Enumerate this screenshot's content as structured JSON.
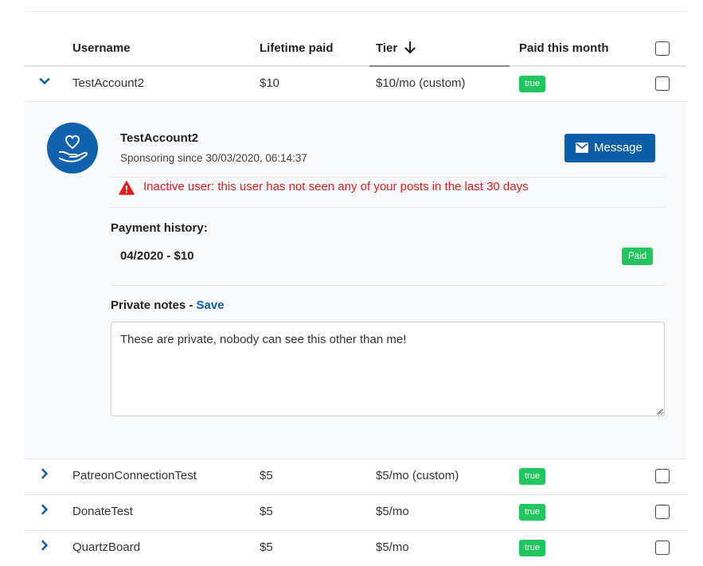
{
  "table": {
    "headers": {
      "username": "Username",
      "lifetime_paid": "Lifetime paid",
      "tier": "Tier",
      "paid_this_month": "Paid this month",
      "sort_icon": "arrow-down-icon"
    },
    "expanded_row": {
      "username": "TestAccount2",
      "lifetime_paid": "$10",
      "tier": "$10/mo (custom)",
      "paid_this_month": "true"
    },
    "rows": [
      {
        "username": "PatreonConnectionTest",
        "lifetime_paid": "$5",
        "tier": "$5/mo (custom)",
        "paid_this_month": "true"
      },
      {
        "username": "DonateTest",
        "lifetime_paid": "$5",
        "tier": "$5/mo",
        "paid_this_month": "true"
      },
      {
        "username": "QuartzBoard",
        "lifetime_paid": "$5",
        "tier": "$5/mo",
        "paid_this_month": "true"
      }
    ]
  },
  "detail": {
    "name": "TestAccount2",
    "sponsoring_since": "Sponsoring since 30/03/2020, 06:14:37",
    "message_button": "Message",
    "warning": "Inactive user: this user has not seen any of your posts in the last 30 days",
    "payment_history_label": "Payment history:",
    "payment_item": "04/2020 - $10",
    "payment_status": "Paid",
    "private_notes_label": "Private notes - ",
    "save_label": "Save",
    "notes_text": "These are private, nobody can see this other than me!",
    "avatar_icon": "hand-heart-icon"
  },
  "colors": {
    "accent": "#0d5ea8",
    "success": "#22c55e",
    "warning": "#e31b1b",
    "detail_background": "#f8f9fa"
  }
}
